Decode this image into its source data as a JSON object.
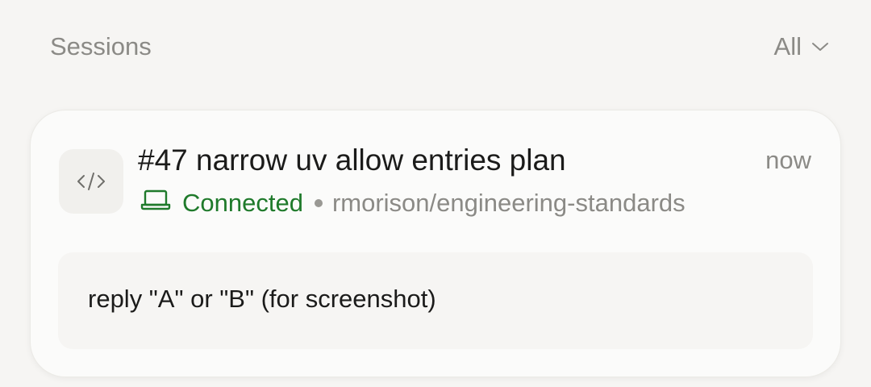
{
  "header": {
    "title": "Sessions",
    "filter": {
      "selected": "All",
      "icon": "chevron-down-icon"
    }
  },
  "session": {
    "icon": "code-icon",
    "title": "#47 narrow uv allow entries plan",
    "timestamp": "now",
    "status": {
      "icon": "laptop-icon",
      "label": "Connected",
      "color": "#1f7a2b"
    },
    "repository": "rmorison/engineering-standards",
    "message": "reply \"A\" or \"B\" (for screenshot)"
  },
  "colors": {
    "background": "#f6f5f3",
    "card": "#fbfbfa",
    "muted_text": "#8b8a86",
    "primary_text": "#1b1b1a"
  }
}
